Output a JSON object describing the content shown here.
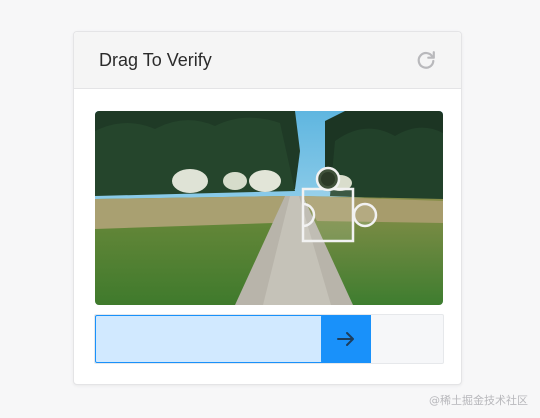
{
  "header": {
    "title": "Drag To Verify",
    "refresh_icon": "refresh-icon"
  },
  "puzzle": {
    "image_description_icon": "puzzle-piece-icon"
  },
  "slider": {
    "handle_icon": "arrow-right-icon",
    "fill_color": "#d1e9ff",
    "accent_color": "#1991fa",
    "progress": 0.79
  },
  "watermark": {
    "text": "@稀土掘金技术社区"
  }
}
